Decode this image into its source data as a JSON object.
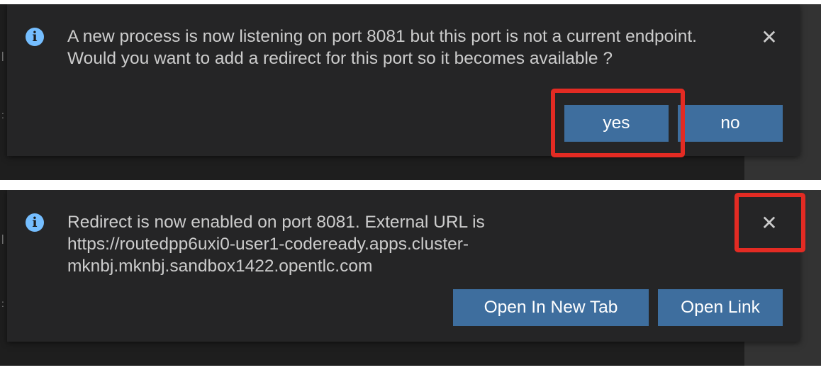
{
  "notification1": {
    "message": "A new process is now listening on port 8081 but this port is not a current endpoint. Would you want to add a redirect for this port so it becomes available ?",
    "close_symbol": "✕",
    "buttons": {
      "yes": "yes",
      "no": "no"
    }
  },
  "notification2": {
    "message": "Redirect is now enabled on port 8081. External URL is https://routedpp6uxi0-user1-codeready.apps.cluster-mknbj.mknbj.sandbox1422.opentlc.com",
    "close_symbol": "✕",
    "buttons": {
      "open_new_tab": "Open In New Tab",
      "open_link": "Open Link"
    }
  },
  "icons": {
    "info": "i"
  },
  "colors": {
    "highlight": "#e32b23",
    "button": "#3e6e9e",
    "toast_bg": "#252526",
    "info_icon": "#75beff"
  }
}
